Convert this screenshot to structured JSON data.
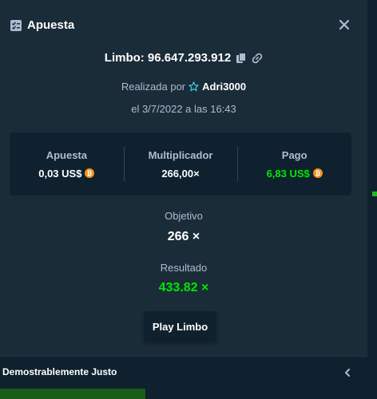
{
  "colors": {
    "modal_bg": "#1a2c38",
    "panel_bg": "#0f212e",
    "label": "#b1bad3",
    "white": "#ffffff",
    "win_green": "#00e701",
    "bitcoin": "#f7931a"
  },
  "header": {
    "title": "Apuesta",
    "title_icon": "bet-slip-icon",
    "close_icon": "close-icon"
  },
  "bet": {
    "id_label": "Limbo: 96.647.293.912",
    "copy_icon": "copy-icon",
    "link_icon": "link-icon"
  },
  "placed": {
    "prefix": "Realizada por",
    "user_icon": "star-icon",
    "user": "Adri3000",
    "date": "el 3/7/2022 a las 16:43"
  },
  "stats": [
    {
      "label": "Apuesta",
      "value": "0,03 US$",
      "coin": "bitcoin-icon"
    },
    {
      "label": "Multiplicador",
      "value": "266,00×"
    },
    {
      "label": "Pago",
      "value": "6,83 US$",
      "coin": "bitcoin-icon"
    }
  ],
  "target": {
    "label": "Objetivo",
    "value": "266 ×"
  },
  "result": {
    "label": "Resultado",
    "value": "433.82 ×"
  },
  "play_button": "Play Limbo",
  "footer": {
    "label": "Demostrablemente Justo",
    "chevron_icon": "chevron-left-icon"
  }
}
